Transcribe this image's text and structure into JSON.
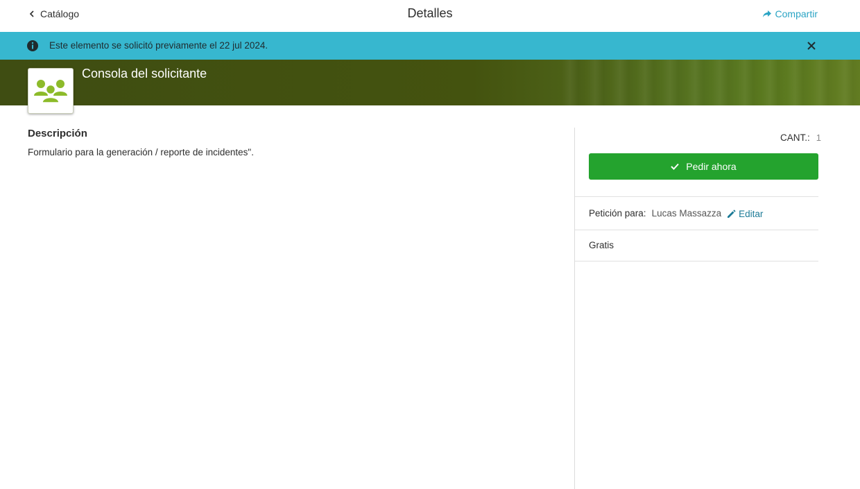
{
  "header": {
    "back_label": "Catálogo",
    "title": "Detalles",
    "share_label": "Compartir"
  },
  "banner": {
    "message": "Este elemento se solicitó previamente el 22 jul 2024."
  },
  "item": {
    "title": "Consola del solicitante",
    "icon": "group-icon"
  },
  "description": {
    "heading": "Descripción",
    "text": "Formulario para la generación / reporte de incidentes\"."
  },
  "order_panel": {
    "qty_label": "CANT.:",
    "qty_value": "1",
    "order_button": "Pedir ahora",
    "request_for_label": "Petición para:",
    "request_for_value": "Lucas Massazza",
    "edit_label": "Editar",
    "price": "Gratis"
  },
  "colors": {
    "banner": "#37b7cf",
    "accent_link": "#2aa4c4",
    "order_button": "#24a32e",
    "hero": "#44530f",
    "icon_green": "#8dbb2a"
  }
}
